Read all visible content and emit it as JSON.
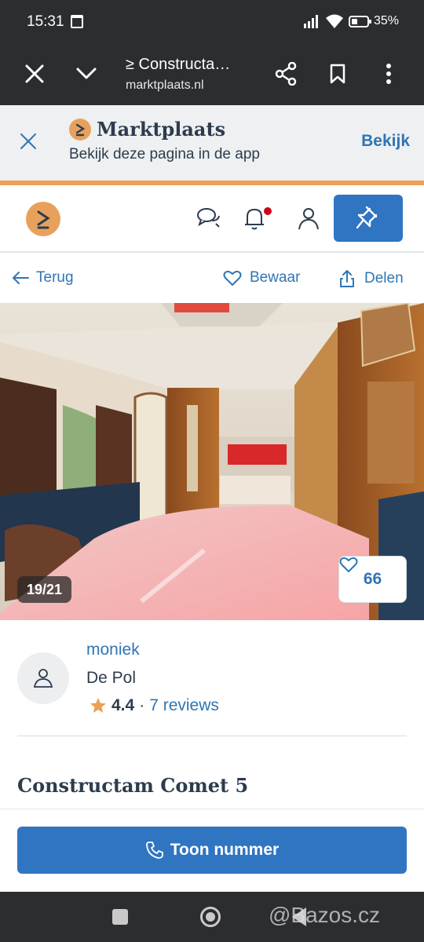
{
  "status": {
    "time": "15:31",
    "battery": "35%"
  },
  "browser": {
    "title": "≥ Constructa…",
    "url": "marktplaats.nl"
  },
  "app_banner": {
    "brand": "Marktplaats",
    "subtitle": "Bekijk deze pagina in de app",
    "open_label": "Bekijk"
  },
  "actions": {
    "back": "Terug",
    "save": "Bewaar",
    "share": "Delen"
  },
  "photo": {
    "counter": "19/21",
    "likes": "66"
  },
  "seller": {
    "name": "moniek",
    "location": "De Pol",
    "rating": "4.4",
    "separator": "·",
    "reviews": "7 reviews"
  },
  "listing": {
    "title": "Constructam Comet 5"
  },
  "call": {
    "label": "Toon nummer"
  },
  "watermark": "@Bazos.cz",
  "colors": {
    "brand_orange": "#eca056",
    "link_blue": "#2f75b5",
    "button_blue": "#2f75c2",
    "dark_bar": "#2b2d30"
  }
}
